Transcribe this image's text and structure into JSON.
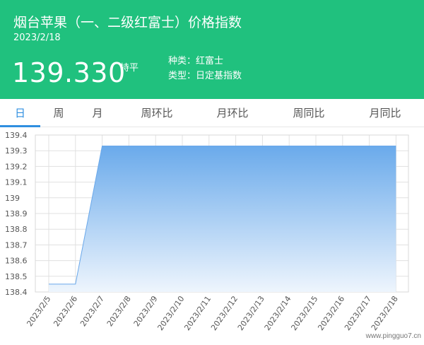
{
  "header": {
    "title": "烟台苹果（一、二级红富士）价格指数",
    "date": "2023/2/18",
    "price": "139.330",
    "change": "持平",
    "meta": [
      {
        "label": "种类：",
        "value": "红富士"
      },
      {
        "label": "类型：",
        "value": "日定基指数"
      }
    ]
  },
  "tabs": [
    {
      "label": "日",
      "active": true
    },
    {
      "label": "周",
      "active": false
    },
    {
      "label": "月",
      "active": false
    },
    {
      "label": "周环比",
      "active": false
    },
    {
      "label": "月环比",
      "active": false
    },
    {
      "label": "周同比",
      "active": false
    },
    {
      "label": "月同比",
      "active": false
    }
  ],
  "chart_data": {
    "type": "area",
    "title": "",
    "xlabel": "",
    "ylabel": "",
    "x": [
      "2023/2/5",
      "2023/2/6",
      "2023/2/7",
      "2023/2/8",
      "2023/2/9",
      "2023/2/10",
      "2023/2/11",
      "2023/2/12",
      "2023/2/13",
      "2023/2/14",
      "2023/2/15",
      "2023/2/16",
      "2023/2/17",
      "2023/2/18"
    ],
    "series": [
      {
        "values": [
          138.45,
          138.45,
          139.33,
          139.33,
          139.33,
          139.33,
          139.33,
          139.33,
          139.33,
          139.33,
          139.33,
          139.33,
          139.33,
          139.33
        ]
      }
    ],
    "yticks": [
      "138.4",
      "138.5",
      "138.6",
      "138.7",
      "138.8",
      "138.9",
      "139",
      "139.1",
      "139.2",
      "139.3",
      "139.4"
    ],
    "ylim": [
      138.4,
      139.4
    ],
    "grid": true,
    "colors": {
      "line": "#6aa8ea",
      "fill_top": "#6aaaeb",
      "fill_bottom": "#eef5fd",
      "grid": "#e0e0e0"
    }
  },
  "watermark": "www.pingguo7.cn",
  "colors": {
    "brand": "#20c17e",
    "accent": "#2f8fe0"
  }
}
